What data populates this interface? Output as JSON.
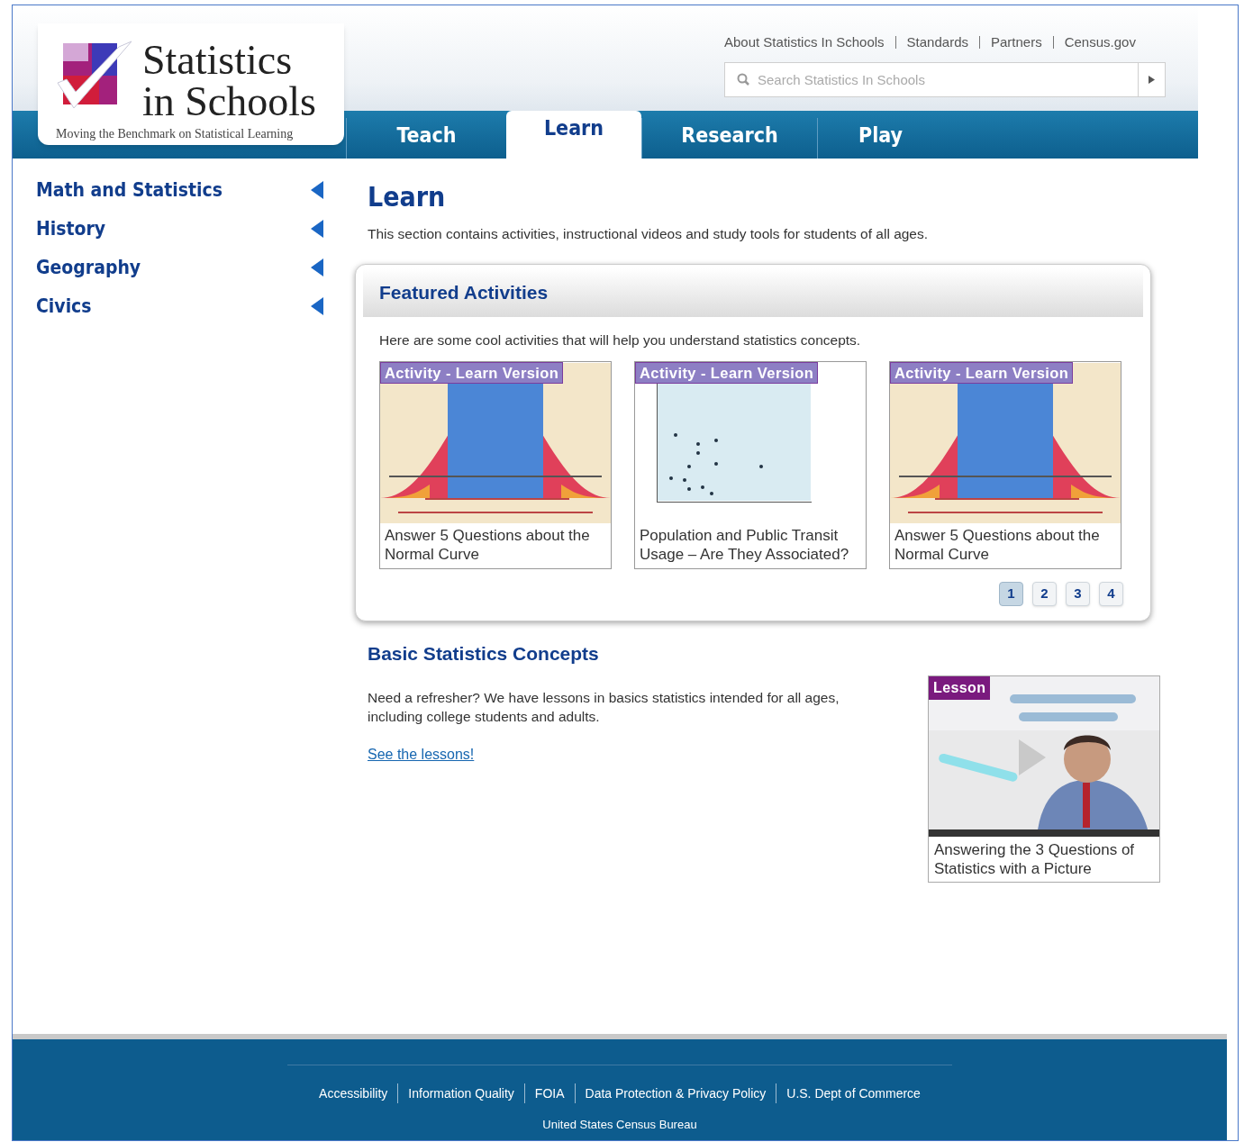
{
  "header": {
    "logo": {
      "title_line_1": "Statistics",
      "title_line_2": "in Schools",
      "tagline": "Moving the Benchmark on Statistical Learning"
    },
    "top_links": [
      "About Statistics In Schools",
      "Standards",
      "Partners",
      "Census.gov"
    ],
    "search": {
      "placeholder": "Search Statistics In Schools"
    },
    "tabs": [
      {
        "label": "Teach",
        "selected": false
      },
      {
        "label": "Learn",
        "selected": true
      },
      {
        "label": "Research",
        "selected": false
      },
      {
        "label": "Play",
        "selected": false
      }
    ]
  },
  "sidebar": {
    "items": [
      {
        "label": "Math and Statistics"
      },
      {
        "label": "History"
      },
      {
        "label": "Geography"
      },
      {
        "label": "Civics"
      }
    ]
  },
  "main": {
    "title": "Learn",
    "intro": "This section contains activities, instructional videos and study tools for students of all ages.",
    "featured": {
      "title": "Featured Activities",
      "intro": "Here are some cool activities that will help you understand statistics concepts.",
      "cards": [
        {
          "badge": "Activity - Learn Version",
          "kind": "curve",
          "caption": "Answer 5 Questions about the Normal Curve"
        },
        {
          "badge": "Activity - Learn Version",
          "kind": "scatter",
          "caption": "Population and Public Transit Usage – Are They Associated?"
        },
        {
          "badge": "Activity - Learn Version",
          "kind": "curve",
          "caption": "Answer 5 Questions about the Normal Curve"
        }
      ],
      "pages": [
        {
          "label": "1",
          "selected": true
        },
        {
          "label": "2",
          "selected": false
        },
        {
          "label": "3",
          "selected": false
        },
        {
          "label": "4",
          "selected": false
        }
      ]
    },
    "basics": {
      "title": "Basic Statistics Concepts",
      "text": "Need a refresher? We have lessons in basics statistics intended for all ages, including college students and adults.",
      "link": "See the lessons!",
      "video": {
        "badge": "Lesson",
        "caption": "Answering the 3 Questions of Statistics with a Picture"
      }
    }
  },
  "footer": {
    "links": [
      "Accessibility",
      "Information Quality",
      "FOIA",
      "Data Protection & Privacy Policy",
      "U.S. Dept of Commerce"
    ],
    "bureau": "United States Census Bureau"
  }
}
